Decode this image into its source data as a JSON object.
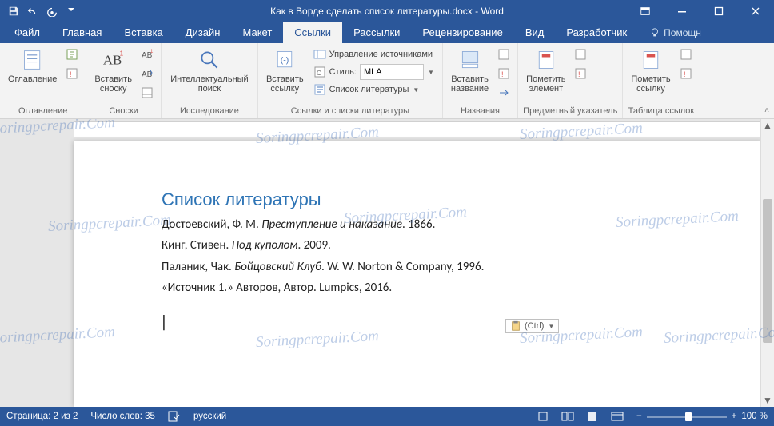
{
  "app": {
    "title": "Как в Ворде сделать список литературы.docx - Word"
  },
  "tabs": {
    "file": "Файл",
    "home": "Главная",
    "insert": "Вставка",
    "design": "Дизайн",
    "layout": "Макет",
    "references": "Ссылки",
    "mailings": "Рассылки",
    "review": "Рецензирование",
    "view": "Вид",
    "developer": "Разработчик",
    "help": "Помощн"
  },
  "ribbon": {
    "toc": {
      "btn": "Оглавление",
      "group": "Оглавление"
    },
    "footnotes": {
      "btn": "Вставить\nсноску",
      "group": "Сноски"
    },
    "research": {
      "btn": "Интеллектуальный\nпоиск",
      "group": "Исследование"
    },
    "citations": {
      "btn": "Вставить\nссылку",
      "manage": "Управление источниками",
      "style_label": "Стиль:",
      "style_value": "MLA",
      "biblio": "Список литературы",
      "group": "Ссылки и списки литературы"
    },
    "captions": {
      "btn": "Вставить\nназвание",
      "group": "Названия"
    },
    "index": {
      "btn": "Пометить\nэлемент",
      "group": "Предметный указатель"
    },
    "toa": {
      "btn": "Пометить\nссылку",
      "group": "Таблица ссылок"
    }
  },
  "document": {
    "bib_heading": "Список литературы",
    "entries": [
      {
        "a": "Достоевский, Ф. М. ",
        "t": "Преступление и наказание",
        "r": ". 1866."
      },
      {
        "a": "Кинг, Стивен. ",
        "t": "Под куполом",
        "r": ". 2009."
      },
      {
        "a": "Паланик, Чак. ",
        "t": "Бойцовский Клуб",
        "r": ". W. W. Norton & Company, 1996."
      },
      {
        "a": "«Источник 1.» Авторов, Автор. Lumpics, 2016.",
        "t": "",
        "r": ""
      }
    ],
    "paste_ctrl": "(Ctrl)"
  },
  "status": {
    "page": "Страница: 2 из 2",
    "words": "Число слов: 35",
    "lang": "русский",
    "zoom": "100 %"
  },
  "watermark": "Soringpcrepair.Com"
}
